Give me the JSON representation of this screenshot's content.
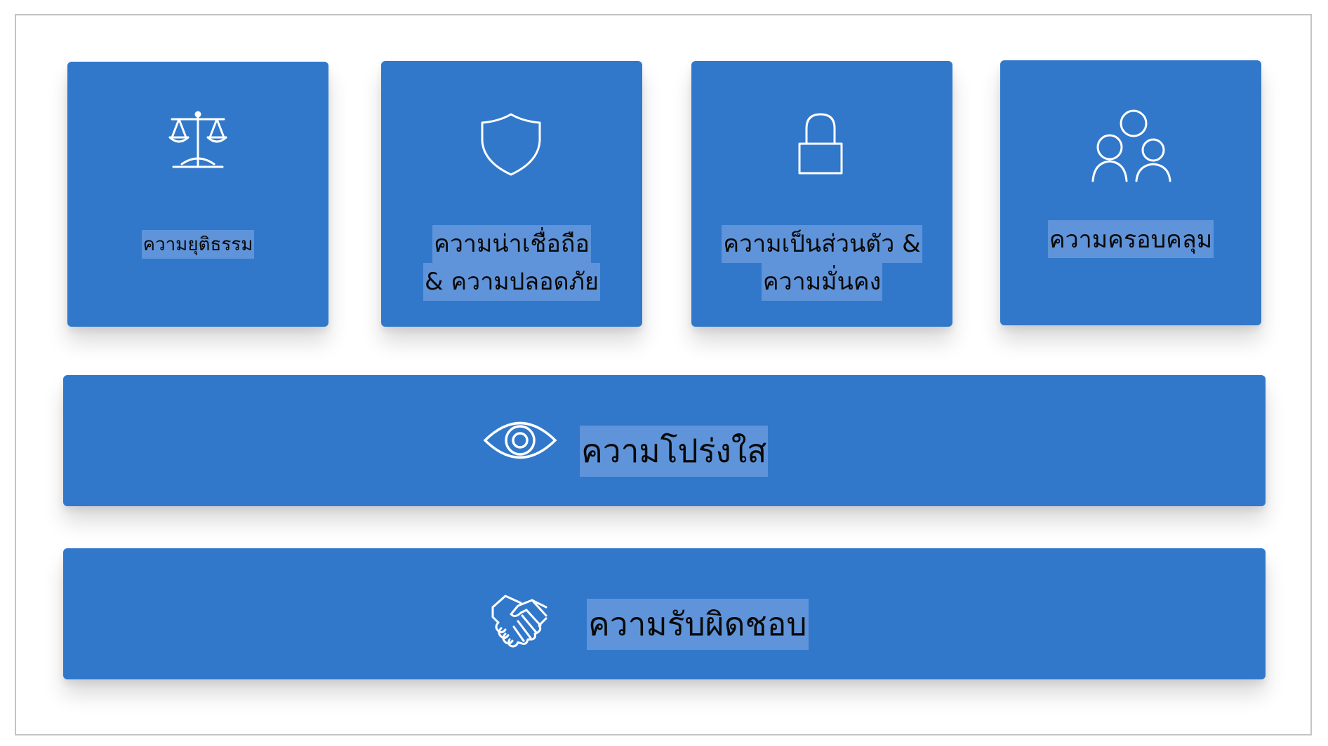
{
  "colors": {
    "card_fill": "#3178cb",
    "label_highlight": "#5f94da",
    "icon_stroke": "#ffffff",
    "text": "#0a0a0a",
    "frame_border": "#c4c4c4"
  },
  "principles": {
    "fairness": {
      "label": "ความยุติธรรม",
      "icon": "scales-icon"
    },
    "reliability": {
      "line1": "ความน่าเชื่อถือ",
      "line2": "& ความปลอดภัย",
      "icon": "shield-icon"
    },
    "privacy": {
      "line1": "ความเป็นส่วนตัว &",
      "line2": "ความมั่นคง",
      "icon": "padlock-icon"
    },
    "inclusiveness": {
      "label": "ความครอบคลุม",
      "icon": "people-group-icon"
    },
    "transparency": {
      "label": "ความโปร่งใส",
      "icon": "eye-icon"
    },
    "accountability": {
      "label": "ความรับผิดชอบ",
      "icon": "handshake-icon"
    }
  }
}
